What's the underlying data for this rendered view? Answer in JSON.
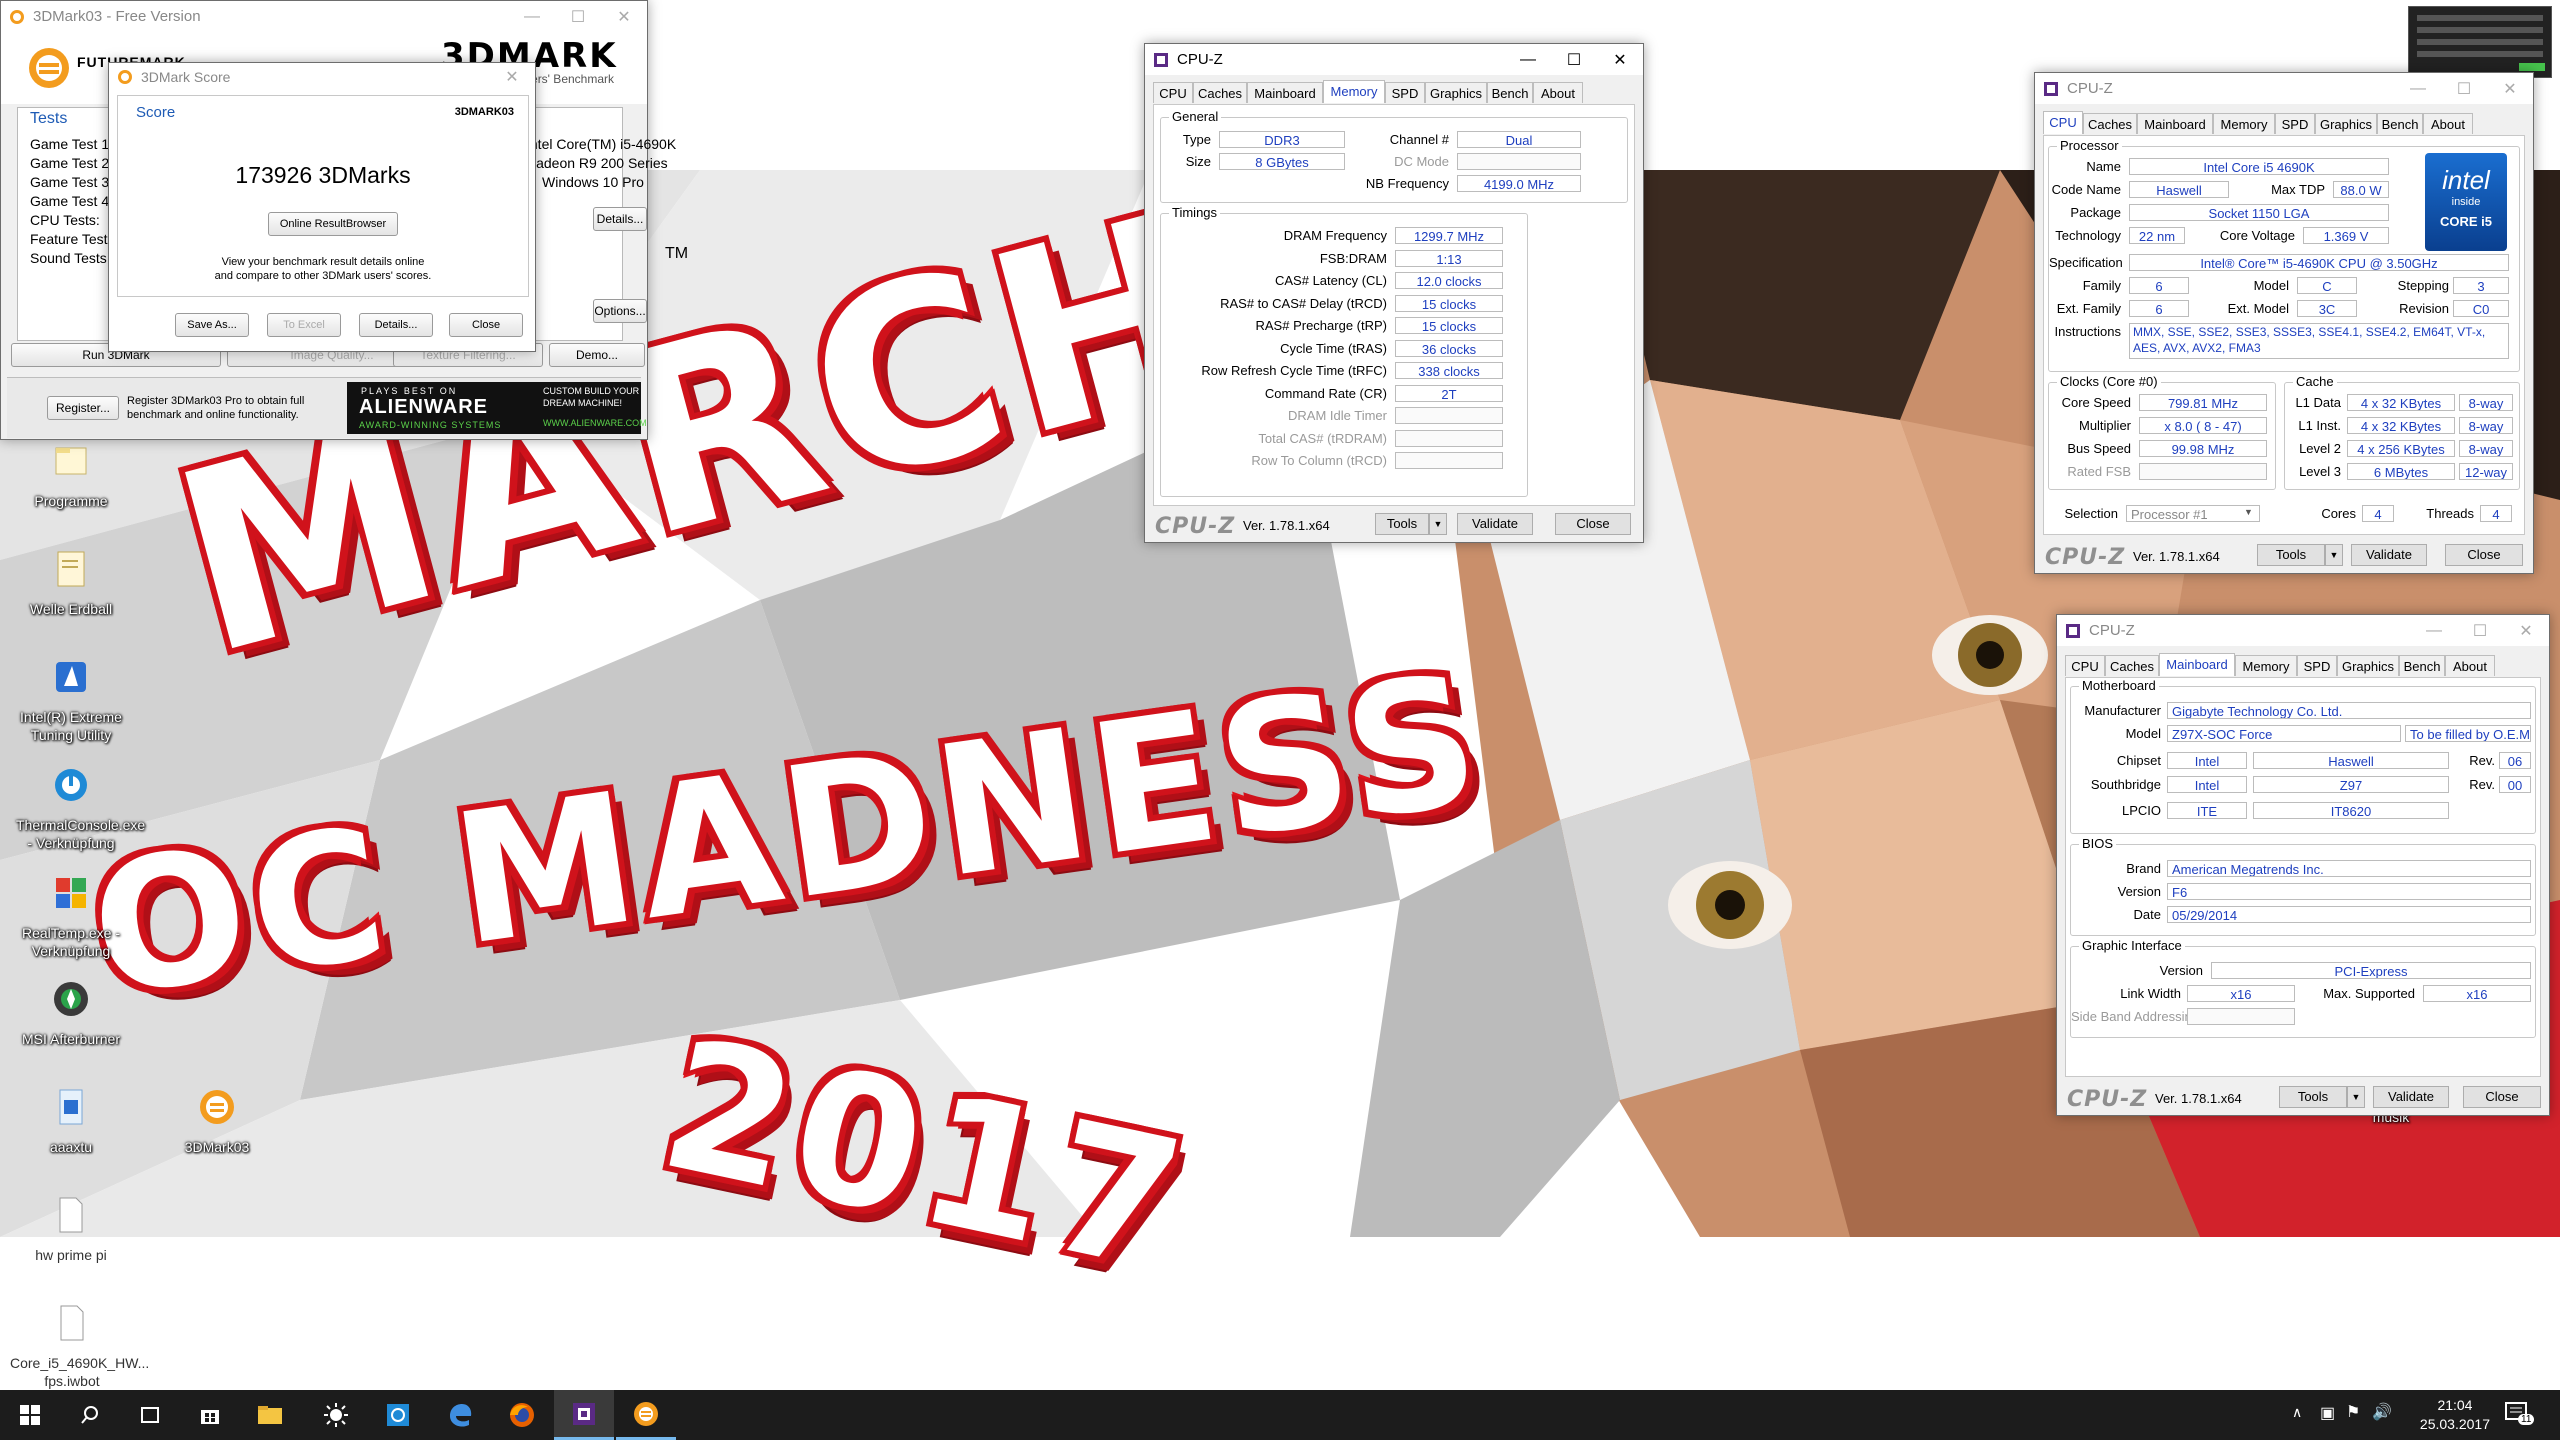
{
  "desktop": {
    "wallpaper_lines": [
      "MARCH",
      "OC MADNESS",
      "2017"
    ],
    "icons": [
      {
        "label": "Programme",
        "icon": "folder-icon"
      },
      {
        "label": "Welle Erdball",
        "icon": "folder-icon"
      },
      {
        "label": "Intel(R) Extreme Tuning Utility",
        "icon": "xtu-icon"
      },
      {
        "label": "ThermalConsole.exe - Verknüpfung",
        "icon": "thermal-icon"
      },
      {
        "label": "RealTemp.exe - Verknüpfung",
        "icon": "realtemp-icon"
      },
      {
        "label": "MSI Afterburner",
        "icon": "afterburner-icon"
      },
      {
        "label": "aaaxtu",
        "icon": "file-icon"
      },
      {
        "label": "3DMark03",
        "icon": "3dmark-icon"
      },
      {
        "label": "hw prime pi",
        "icon": "file-icon"
      },
      {
        "label": "Core_i5_4690K_HW... fps.iwbot",
        "icon": "file-icon"
      },
      {
        "label": "musik",
        "icon": "folder-icon"
      }
    ]
  },
  "taskbar": {
    "time": "21:04",
    "date": "25.03.2017",
    "notification_count": "11"
  },
  "tdmark_main": {
    "title": "3DMark03 - Free Version",
    "brand_futuremark": "FUTUREMARK",
    "brand_3dmark": "3DMARK",
    "brand_3dmark_sub": "The Gamers' Benchmark",
    "tests_heading": "Tests",
    "tests": [
      "Game Test 1",
      "Game Test 2",
      "Game Test 3",
      "Game Test 4",
      "CPU Tests:",
      "Feature Tests:",
      "Sound Tests:"
    ],
    "system_lines": [
      "Intel Core(TM) i5-4690K",
      "Radeon R9 200 Series",
      "Windows 10 Pro"
    ],
    "details_button": "Details...",
    "options_button": "Options...",
    "tm": "TM",
    "bottom_buttons": [
      "Run 3DMark",
      "Image Quality...",
      "Texture Filtering...",
      "Demo..."
    ],
    "register_button": "Register...",
    "register_text": "Register 3DMark03 Pro to obtain full benchmark and online functionality.",
    "ad_line1": "PLAYS BEST ON",
    "ad_brand": "ALIENWARE",
    "ad_line2": "AWARD-WINNING SYSTEMS",
    "ad_right1": "CUSTOM BUILD YOUR",
    "ad_right2": "DREAM MACHINE!",
    "ad_url": "WWW.ALIENWARE.COM"
  },
  "tdmark_score": {
    "title": "3DMark Score",
    "score_heading": "Score",
    "logo": "3DMARK03",
    "score": "173926 3DMarks",
    "online_button": "Online ResultBrowser",
    "info_text_1": "View your benchmark result details online",
    "info_text_2": "and compare to other 3DMark users' scores.",
    "buttons": {
      "save": "Save As...",
      "excel": "To Excel",
      "details": "Details...",
      "close": "Close"
    }
  },
  "cpuz_common": {
    "title": "CPU-Z",
    "logo": "CPU-Z",
    "version": "Ver. 1.78.1.x64",
    "tools": "Tools",
    "validate": "Validate",
    "close": "Close",
    "tabs": [
      "CPU",
      "Caches",
      "Mainboard",
      "Memory",
      "SPD",
      "Graphics",
      "Bench",
      "About"
    ]
  },
  "cpuz_memory": {
    "general_title": "General",
    "type_label": "Type",
    "type": "DDR3",
    "size_label": "Size",
    "size": "8 GBytes",
    "channel_label": "Channel #",
    "channel": "Dual",
    "dcmode_label": "DC Mode",
    "nbfreq_label": "NB Frequency",
    "nbfreq": "4199.0 MHz",
    "timings_title": "Timings",
    "timings": [
      {
        "label": "DRAM Frequency",
        "value": "1299.7 MHz",
        "dim": false
      },
      {
        "label": "FSB:DRAM",
        "value": "1:13",
        "dim": false
      },
      {
        "label": "CAS# Latency (CL)",
        "value": "12.0 clocks",
        "dim": false
      },
      {
        "label": "RAS# to CAS# Delay (tRCD)",
        "value": "15 clocks",
        "dim": false
      },
      {
        "label": "RAS# Precharge (tRP)",
        "value": "15 clocks",
        "dim": false
      },
      {
        "label": "Cycle Time (tRAS)",
        "value": "36 clocks",
        "dim": false
      },
      {
        "label": "Row Refresh Cycle Time (tRFC)",
        "value": "338 clocks",
        "dim": false
      },
      {
        "label": "Command Rate (CR)",
        "value": "2T",
        "dim": false
      },
      {
        "label": "DRAM Idle Timer",
        "value": "",
        "dim": true
      },
      {
        "label": "Total CAS# (tRDRAM)",
        "value": "",
        "dim": true
      },
      {
        "label": "Row To Column (tRCD)",
        "value": "",
        "dim": true
      }
    ]
  },
  "cpuz_cpu": {
    "processor_title": "Processor",
    "name_label": "Name",
    "name": "Intel Core i5 4690K",
    "codename_label": "Code Name",
    "codename": "Haswell",
    "maxtdp_label": "Max TDP",
    "maxtdp": "88.0 W",
    "package_label": "Package",
    "package": "Socket 1150 LGA",
    "tech_label": "Technology",
    "tech": "22 nm",
    "voltage_label": "Core Voltage",
    "voltage": "1.369 V",
    "spec_label": "Specification",
    "spec": "Intel® Core™ i5-4690K CPU @ 3.50GHz",
    "family_label": "Family",
    "family": "6",
    "model_label": "Model",
    "model": "C",
    "stepping_label": "Stepping",
    "stepping": "3",
    "extfamily_label": "Ext. Family",
    "extfamily": "6",
    "extmodel_label": "Ext. Model",
    "extmodel": "3C",
    "revision_label": "Revision",
    "revision": "C0",
    "instr_label": "Instructions",
    "instr_1": "MMX, SSE, SSE2, SSE3, SSSE3, SSE4.1, SSE4.2, EM64T, VT-x,",
    "instr_2": "AES, AVX, AVX2, FMA3",
    "clocks_title": "Clocks (Core #0)",
    "corespeed_label": "Core Speed",
    "corespeed": "799.81 MHz",
    "multiplier_label": "Multiplier",
    "multiplier": "x 8.0 ( 8 - 47)",
    "busspeed_label": "Bus Speed",
    "busspeed": "99.98 MHz",
    "ratedfsb_label": "Rated FSB",
    "cache_title": "Cache",
    "caches": [
      {
        "label": "L1 Data",
        "size": "4 x 32 KBytes",
        "way": "8-way"
      },
      {
        "label": "L1 Inst.",
        "size": "4 x 32 KBytes",
        "way": "8-way"
      },
      {
        "label": "Level 2",
        "size": "4 x 256 KBytes",
        "way": "8-way"
      },
      {
        "label": "Level 3",
        "size": "6 MBytes",
        "way": "12-way"
      }
    ],
    "selection_label": "Selection",
    "selection": "Processor #1",
    "cores_label": "Cores",
    "cores": "4",
    "threads_label": "Threads",
    "threads": "4",
    "intel_logo_1": "intel",
    "intel_logo_2": "inside",
    "intel_logo_3": "CORE i5"
  },
  "cpuz_mainboard": {
    "mb_title": "Motherboard",
    "manufacturer_label": "Manufacturer",
    "manufacturer": "Gigabyte Technology Co. Ltd.",
    "model_label": "Model",
    "model": "Z97X-SOC Force",
    "model_extra": "To be filled by O.E.M.",
    "chipset_label": "Chipset",
    "chipset_vendor": "Intel",
    "chipset_name": "Haswell",
    "chipset_rev_label": "Rev.",
    "chipset_rev": "06",
    "south_label": "Southbridge",
    "south_vendor": "Intel",
    "south_name": "Z97",
    "south_rev_label": "Rev.",
    "south_rev": "00",
    "lpcio_label": "LPCIO",
    "lpcio_vendor": "ITE",
    "lpcio_name": "IT8620",
    "bios_title": "BIOS",
    "brand_label": "Brand",
    "brand": "American Megatrends Inc.",
    "version_label": "Version",
    "version": "F6",
    "date_label": "Date",
    "date": "05/29/2014",
    "gi_title": "Graphic Interface",
    "gi_version_label": "Version",
    "gi_version": "PCI-Express",
    "linkwidth_label": "Link Width",
    "linkwidth": "x16",
    "maxsupported_label": "Max. Supported",
    "maxsupported": "x16",
    "sideband_label": "Side Band Addressing"
  }
}
